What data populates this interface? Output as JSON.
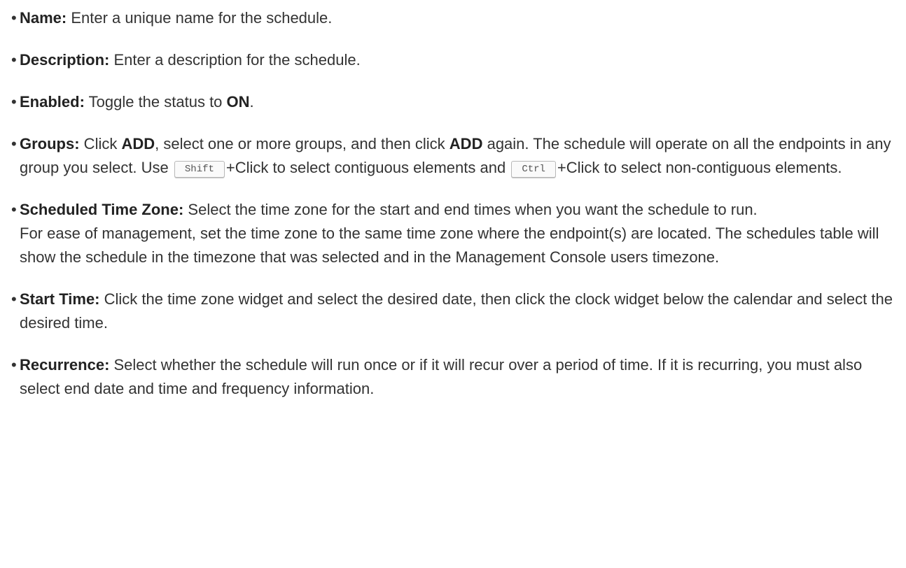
{
  "items": [
    {
      "term": "Name:",
      "text": " Enter a unique name for the schedule."
    },
    {
      "term": "Description:",
      "text": " Enter a description for the schedule."
    },
    {
      "term": "Enabled:",
      "text_before": " Toggle the status to ",
      "strong": "ON",
      "text_after": "."
    },
    {
      "term": "Groups:",
      "t1": " Click ",
      "s1": "ADD",
      "t2": ", select one or more groups, and then click ",
      "s2": "ADD",
      "t3": " again. The schedule will operate on all the endpoints in any group you select. Use ",
      "key1": "Shift",
      "t4": "+Click to select contiguous elements and ",
      "key2": "Ctrl",
      "t5": "+Click to select non-contiguous elements."
    },
    {
      "term": "Scheduled Time Zone:",
      "text": " Select the time zone for the start and end times when you want the schedule to run.",
      "note": "For ease of management, set the time zone to the same time zone where the endpoint(s) are located. The schedules table will show the schedule in the timezone that was selected and in the Management Console users timezone."
    },
    {
      "term": "Start Time:",
      "text": " Click the time zone widget and select the desired date, then click the clock widget below the calendar and select the desired time."
    },
    {
      "term": "Recurrence:",
      "text": " Select whether the schedule will run once or if it will recur over a period of time. If it is recurring, you must also select end date and time and frequency information."
    }
  ],
  "bullet_char": "•"
}
